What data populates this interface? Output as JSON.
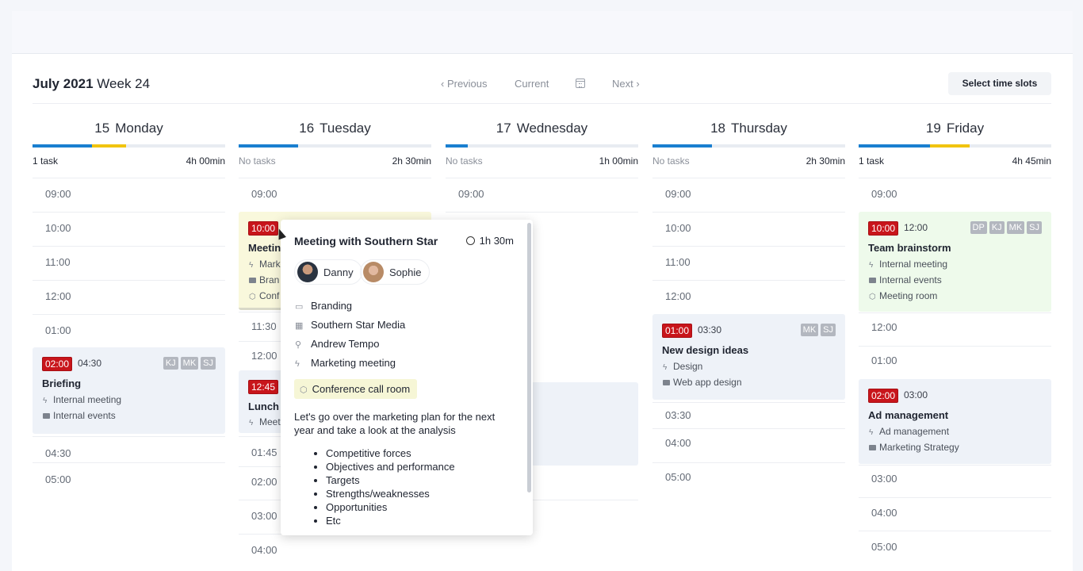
{
  "header": {
    "month_label": "July 2021",
    "week_label": "Week 24",
    "previous": "‹ Previous",
    "current": "Current",
    "calendar_icon": "calendar-icon",
    "next": "Next ›",
    "select_slots": "Select time slots"
  },
  "colors": {
    "blue": "#1a7fd0",
    "yellow": "#f1c40f",
    "red": "#c8151b"
  },
  "days": [
    {
      "num": "15",
      "name": "Monday",
      "tasks": "1 task",
      "duration": "4h 00min",
      "slots": [
        "09:00",
        "10:00",
        "11:00",
        "12:00",
        "01:00",
        "04:30",
        "05:00"
      ],
      "event": {
        "start": "02:00",
        "end": "04:30",
        "badges": [
          "KJ",
          "MK",
          "SJ"
        ],
        "title": "Briefing",
        "type": "Internal meeting",
        "project": "Internal events"
      }
    },
    {
      "num": "16",
      "name": "Tuesday",
      "tasks": "No tasks",
      "duration": "2h 30min",
      "slots": [
        "09:00",
        "11:30",
        "12:00",
        "01:45",
        "02:00",
        "03:00",
        "04:00"
      ],
      "event1": {
        "start": "10:00",
        "title": "Meetin",
        "type": "Mark",
        "project": "Bran",
        "room": "Conf"
      },
      "event2": {
        "start": "12:45",
        "title": "Lunch v",
        "type": "Meet"
      }
    },
    {
      "num": "17",
      "name": "Wednesday",
      "tasks": "No tasks",
      "duration": "1h 00min",
      "slots": [
        "09:00"
      ]
    },
    {
      "num": "18",
      "name": "Thursday",
      "tasks": "No tasks",
      "duration": "2h 30min",
      "slots": [
        "09:00",
        "10:00",
        "11:00",
        "12:00",
        "03:30",
        "04:00",
        "05:00"
      ],
      "event": {
        "start": "01:00",
        "end": "03:30",
        "badges": [
          "MK",
          "SJ"
        ],
        "title": "New design ideas",
        "type": "Design",
        "project": "Web app design"
      }
    },
    {
      "num": "19",
      "name": "Friday",
      "tasks": "1 task",
      "duration": "4h 45min",
      "slots": [
        "09:00",
        "12:00",
        "01:00",
        "03:00",
        "04:00",
        "05:00"
      ],
      "event1": {
        "start": "10:00",
        "end": "12:00",
        "badges": [
          "DP",
          "KJ",
          "MK",
          "SJ"
        ],
        "title": "Team brainstorm",
        "type": "Internal meeting",
        "project": "Internal events",
        "room": "Meeting room"
      },
      "event2": {
        "start": "02:00",
        "end": "03:00",
        "title": "Ad management",
        "type": "Ad management",
        "project": "Marketing Strategy"
      }
    }
  ],
  "popup": {
    "title": "Meeting with Southern Star",
    "duration": "1h 30m",
    "people": [
      "Danny",
      "Sophie"
    ],
    "project": "Branding",
    "company": "Southern Star Media",
    "owner": "Andrew Tempo",
    "type": "Marketing meeting",
    "room": "Conference call room",
    "description": "Let's go over the marketing plan for the next year and take a look at the analysis",
    "items": [
      "Competitive forces",
      "Objectives and performance",
      "Targets",
      "Strengths/weaknesses",
      "Opportunities",
      "Etc"
    ]
  }
}
